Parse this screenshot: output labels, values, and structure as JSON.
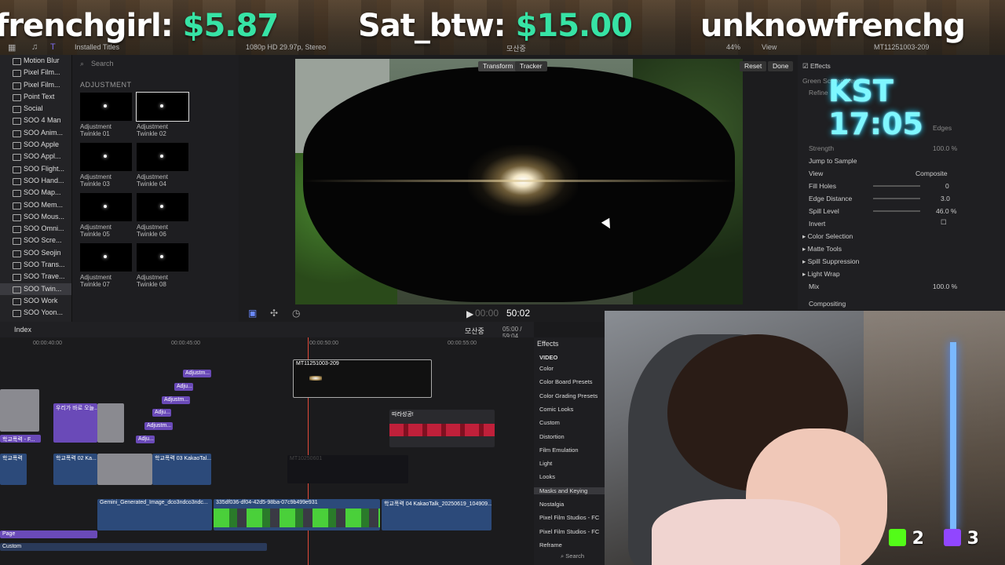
{
  "banner": {
    "items": [
      {
        "name": "frenchgirl:",
        "amount": "$5.87"
      },
      {
        "name": "Sat_btw:",
        "amount": "$15.00"
      },
      {
        "name": "unknowfrenchg",
        "amount": ""
      }
    ]
  },
  "toolbar": {
    "installed_titles": "Installed Titles",
    "format": "1080p HD 29.97p, Stereo",
    "project": "모산중",
    "zoom": "44%",
    "view": "View",
    "clip_name": "MT11251003-209"
  },
  "sidebar": {
    "items": [
      "Motion Blur",
      "Pixel Film...",
      "Pixel Film...",
      "Point Text",
      "Social",
      "SOO 4 Man",
      "SOO Anim...",
      "SOO Apple",
      "SOO Appl...",
      "SOO Flight...",
      "SOO Hand...",
      "SOO Map...",
      "SOO Mem...",
      "SOO Mous...",
      "SOO Omni...",
      "SOO Scre...",
      "SOO Seojin",
      "SOO Trans...",
      "SOO Trave...",
      "SOO Twin...",
      "SOO Work",
      "SOO Yoon..."
    ],
    "selected_index": 19
  },
  "browser": {
    "search_placeholder": "Search",
    "section": "ADJUSTMENT",
    "items": [
      {
        "l1": "Adjustment",
        "l2": "Twinkle 01"
      },
      {
        "l1": "Adjustment",
        "l2": "Twinkle 02"
      },
      {
        "l1": "Adjustment",
        "l2": "Twinkle 03"
      },
      {
        "l1": "Adjustment",
        "l2": "Twinkle 04"
      },
      {
        "l1": "Adjustment",
        "l2": "Twinkle 05"
      },
      {
        "l1": "Adjustment",
        "l2": "Twinkle 06"
      },
      {
        "l1": "Adjustment",
        "l2": "Twinkle 07"
      },
      {
        "l1": "Adjustment",
        "l2": "Twinkle 08"
      }
    ]
  },
  "viewer": {
    "transform": "Transform",
    "tracker": "Tracker",
    "reset": "Reset",
    "done": "Done",
    "timecode": "00:00",
    "timecode_main": "50:02"
  },
  "overlay": {
    "line1": "KST",
    "line2": "17:05"
  },
  "inspector": {
    "effects": "Effects",
    "green_screen": "Green Screen Keyer",
    "refine": "Refine",
    "edges": "Edges",
    "strength": "Strength",
    "strength_val": "100.0 %",
    "jump": "Jump to Sample",
    "view": "View",
    "composite": "Composite",
    "fill_holes": "Fill Holes",
    "fill_holes_val": "0",
    "edge_distance": "Edge Distance",
    "edge_distance_val": "3.0",
    "spill_level": "Spill Level",
    "spill_level_val": "46.0 %",
    "invert": "Invert",
    "color_selection": "Color Selection",
    "matte_tools": "Matte Tools",
    "spill_suppression": "Spill Suppression",
    "light_wrap": "Light Wrap",
    "mix": "Mix",
    "mix_val": "100.0 %",
    "compositing": "Compositing"
  },
  "timeline": {
    "index": "Index",
    "project": "모산중",
    "duration": "05:00 / 59:04",
    "ticks": [
      "00:00:40:00",
      "00:00:45:00",
      "00:00:50:00",
      "00:00:55:00"
    ],
    "clips": {
      "main": "MT11251003-209",
      "adj1": "Adjustm...",
      "adj2": "Adju...",
      "adj3": "Adjustm...",
      "adj4": "Adju...",
      "adj5": "Adjustm...",
      "adj6": "Adju...",
      "title1": "우리가 바로 오늘...",
      "title2": "학교폭력 - F...",
      "broll": "학교폭력 02 Ka...",
      "broll2": "학교폭력 03 KakaoTal...",
      "broll3": "학교폭력",
      "red": "따라성공!",
      "gemini": "Gemini_Generated_Image_dco3ndco3ndc...",
      "uuid": "335df036-df04-42d5-98ba-07c9b499e931",
      "kakao": "학교폭력 04 KakaoTalk_20250619_104909...",
      "dim": "MT10250601",
      "page": "Page",
      "custom": "Custom"
    }
  },
  "effects": {
    "title": "Effects",
    "category": "VIDEO",
    "items": [
      "Color",
      "Color Board Presets",
      "Color Grading Presets",
      "Comic Looks",
      "Custom",
      "Distortion",
      "Film Emulation",
      "Light",
      "Looks",
      "Masks and Keying",
      "Nostalgia",
      "Pixel Film Studios - FC",
      "Pixel Film Studios - FC",
      "Reframe"
    ],
    "selected_index": 9,
    "search": "Search"
  },
  "badges": {
    "k": "2",
    "t": "3"
  },
  "colors": {
    "donation": "#37e3a5",
    "clip_purple": "#6a4ab8",
    "neon": "#7ff7ff"
  }
}
